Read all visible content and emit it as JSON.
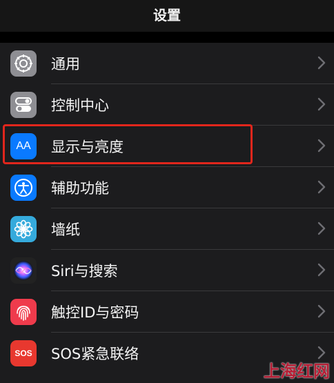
{
  "header": {
    "title": "设置"
  },
  "settings": {
    "items": [
      {
        "label": "通用",
        "icon": "gear-icon",
        "color": "#8e8e93"
      },
      {
        "label": "控制中心",
        "icon": "toggles-icon",
        "color": "#8e8e93"
      },
      {
        "label": "显示与亮度",
        "icon": "text-size-icon",
        "color": "#0a7aff",
        "icon_text": "AA"
      },
      {
        "label": "辅助功能",
        "icon": "accessibility-icon",
        "color": "#0a7aff"
      },
      {
        "label": "墙纸",
        "icon": "flower-icon",
        "color": "#35aadc"
      },
      {
        "label": "Siri与搜索",
        "icon": "siri-icon",
        "color": "#222222"
      },
      {
        "label": "触控ID与密码",
        "icon": "fingerprint-icon",
        "color": "#ef3b4c"
      },
      {
        "label": "SOS紧急联络",
        "icon": "sos-icon",
        "color": "#e8382f",
        "icon_text": "SOS"
      }
    ]
  },
  "highlight_color": "#e1261c",
  "watermark": "上海红网"
}
